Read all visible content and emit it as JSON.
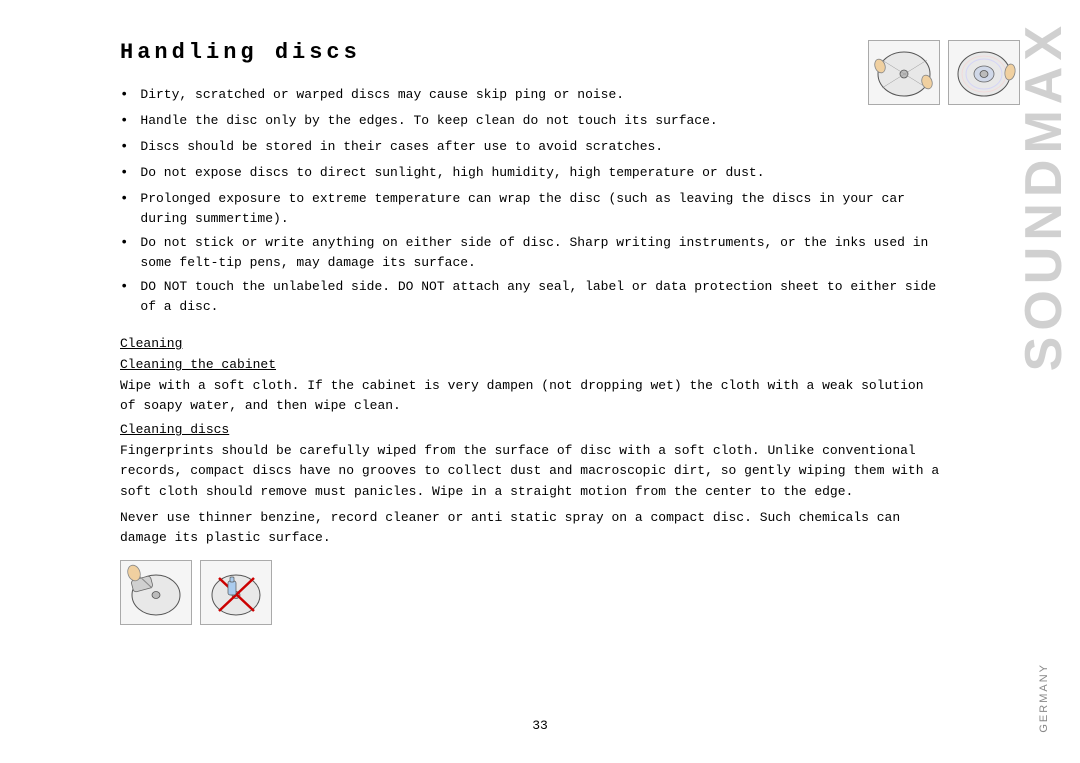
{
  "page": {
    "title": "Handling discs",
    "pageNumber": "33",
    "brand": "SOUNDMAX",
    "germany": "GERMANY"
  },
  "bullets": [
    "Dirty, scratched or warped discs may cause skip ping or noise.",
    "Handle the disc only by the edges. To keep clean do not touch its surface.",
    "Discs should be stored in their cases after use to avoid scratches.",
    "Do not expose discs to direct sunlight, high humidity, high temperature or dust.",
    "Prolonged exposure to extreme temperature can wrap the disc (such as leaving the discs in your car during summertime).",
    "Do not stick or write anything on either side of disc. Sharp writing instruments, or the inks used in some felt-tip pens, may damage its surface.",
    "DO NOT touch the unlabeled side. DO NOT attach any seal, label or data protection sheet to either side of a disc."
  ],
  "sections": {
    "cleaning_heading": "Cleaning",
    "cleaning_cabinet_heading": "Cleaning the cabinet",
    "cleaning_cabinet_text": "Wipe with a soft cloth. If the cabinet is very dampen (not dropping wet) the cloth with a weak solution of soapy water, and then wipe clean.",
    "cleaning_discs_heading": "Cleaning discs",
    "cleaning_discs_text1": "Fingerprints should be carefully wiped from the surface of disc with a soft cloth. Unlike conventional records, compact discs have no grooves to collect dust and macroscopic dirt, so gently wiping them with a soft cloth should remove must panicles. Wipe in a straight motion from the center to the edge.",
    "cleaning_discs_text2": "Never use thinner benzine, record cleaner or anti static spray on a compact disc. Such chemicals can damage its plastic surface."
  }
}
